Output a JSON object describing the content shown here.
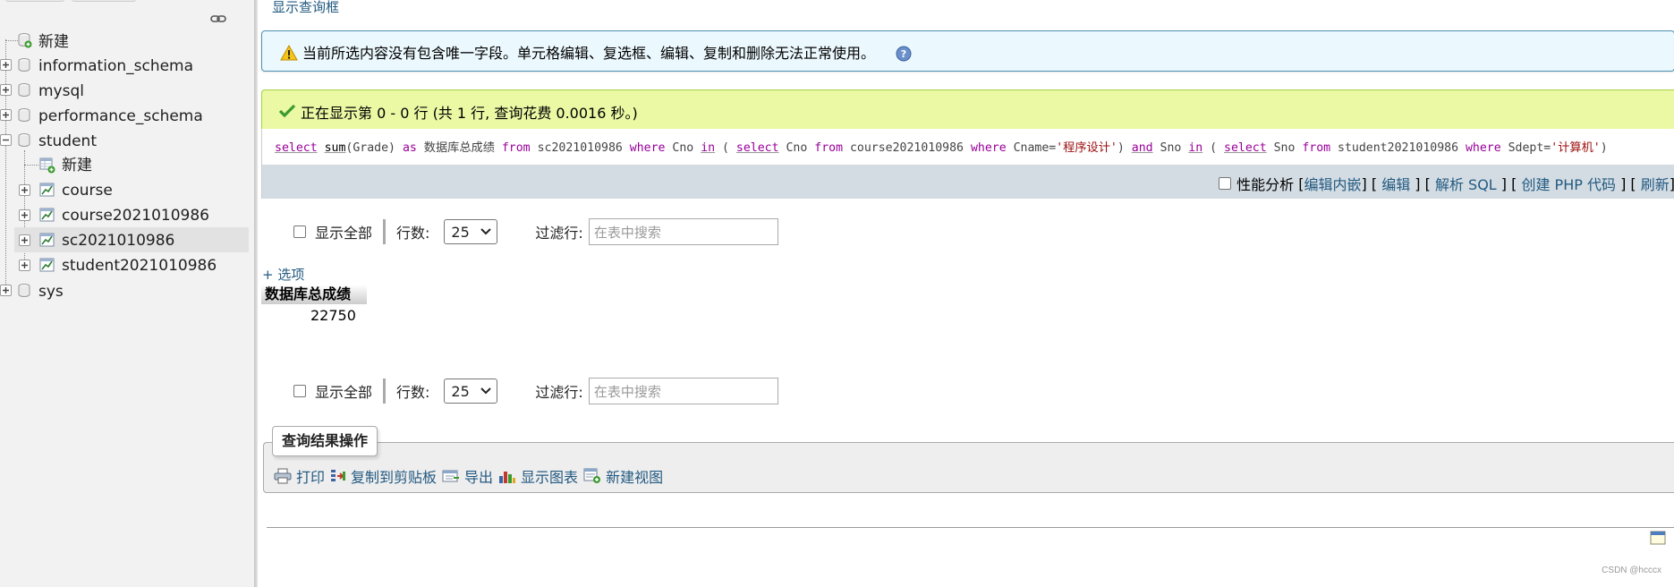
{
  "navigation": {
    "new_item": "新建",
    "databases": [
      {
        "name": "information_schema"
      },
      {
        "name": "mysql"
      },
      {
        "name": "performance_schema"
      },
      {
        "name": "student"
      },
      {
        "name": "sys"
      }
    ],
    "student_children": {
      "new_item": "新建",
      "tables": [
        "course",
        "course2021010986",
        "sc2021010986",
        "student2021010986"
      ],
      "selected_table": "sc2021010986"
    }
  },
  "main": {
    "show_query_link": "显示查询框",
    "notice": "当前所选内容没有包含唯一字段。单元格编辑、复选框、编辑、复制和删除无法正常使用。",
    "success": "正在显示第 0 - 0 行 (共 1 行, 查询花费 0.0016 秒。)",
    "sql": {
      "t01": "select",
      "t02": "sum",
      "t03": "(Grade) ",
      "t04": "as",
      "t05": " 数据库总成绩 ",
      "t06": "from",
      "t07": " sc2021010986 ",
      "t08": "where",
      "t09": " Cno ",
      "t10": "in",
      "t11": " ( ",
      "t12": "select",
      "t13": " Cno ",
      "t14": "from",
      "t15": " course2021010986 ",
      "t16": "where",
      "t17": " Cname=",
      "t18": "'程序设计'",
      "t19": ") ",
      "t20": "and",
      "t21": " Sno ",
      "t22": "in",
      "t23": " ( ",
      "t24": "select",
      "t25": " Sno ",
      "t26": "from",
      "t27": " student2021010986 ",
      "t28": "where",
      "t29": " Sdept=",
      "t30": "'计算机'",
      "t31": ")"
    },
    "tools": {
      "profiling_label": "性能分析",
      "edit_inline": "编辑内嵌",
      "edit": "编辑",
      "explain_sql": "解析 SQL",
      "create_php": "创建 PHP 代码",
      "refresh": "刷新"
    },
    "nav_controls": {
      "show_all": "显示全部",
      "rows_label": "行数:",
      "rows_value": "25",
      "filter_label": "过滤行:",
      "filter_placeholder": "在表中搜索"
    },
    "options_link": "+ 选项",
    "result": {
      "column_header": "数据库总成绩",
      "value": "22750"
    },
    "query_ops": {
      "legend": "查询结果操作",
      "print": "打印",
      "copy_clipboard": "复制到剪贴板",
      "export": "导出",
      "show_chart": "显示图表",
      "create_view": "新建视图"
    }
  },
  "watermark": "CSDN @hcccx"
}
